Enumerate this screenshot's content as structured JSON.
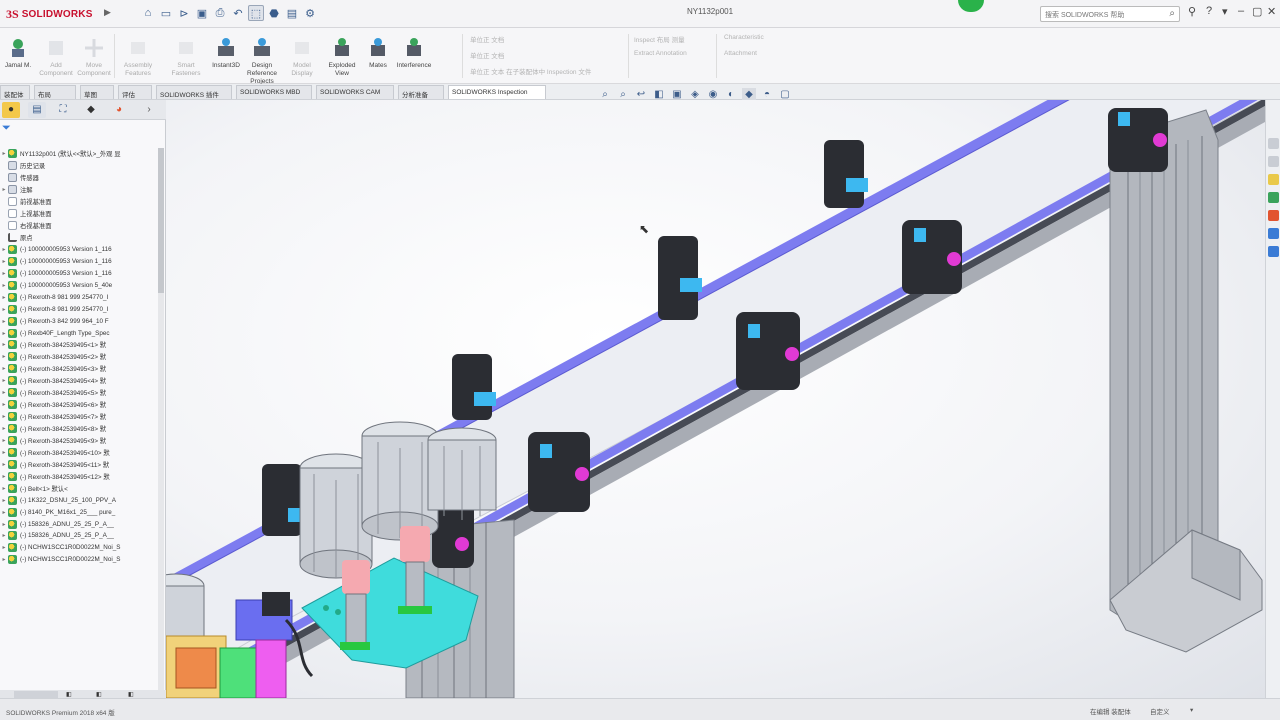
{
  "app": {
    "brand_mark": "3S",
    "brand_name": "SOLIDWORKS",
    "document_title": "NY1132p001"
  },
  "search": {
    "placeholder": "搜索 SOLIDWORKS 帮助"
  },
  "command_manager": {
    "buttons": [
      {
        "label": "Jamal M.",
        "enabled": true
      },
      {
        "label": "Add Component",
        "enabled": false
      },
      {
        "label": "Move Component",
        "enabled": false
      },
      {
        "label": "Assembly Features",
        "enabled": false
      },
      {
        "label": "Smart Fasteners",
        "enabled": true
      },
      {
        "label": "Instant3D",
        "enabled": true
      },
      {
        "label": "Design Reference Projects",
        "enabled": false
      },
      {
        "label": "Model Display",
        "enabled": true
      },
      {
        "label": "Exploded View",
        "enabled": true
      },
      {
        "label": "Mates",
        "enabled": true
      },
      {
        "label": "Interference",
        "enabled": true
      }
    ],
    "small_items": [
      "单位正 文档",
      "单位正 文档",
      "单位正 文本 在子装配体中 Inspection 文件",
      "Inspect 布局 测量",
      "Extract Annotation",
      "Characteristic",
      "Attachment"
    ]
  },
  "tabs": [
    {
      "label": "装配体",
      "active": false
    },
    {
      "label": "布局",
      "active": false
    },
    {
      "label": "草图",
      "active": false
    },
    {
      "label": "评估",
      "active": false
    },
    {
      "label": "SOLIDWORKS 插件",
      "active": false
    },
    {
      "label": "SOLIDWORKS MBD",
      "active": false
    },
    {
      "label": "SOLIDWORKS CAM",
      "active": false
    },
    {
      "label": "分析准备",
      "active": false
    },
    {
      "label": "SOLIDWORKS Inspection",
      "active": true
    }
  ],
  "feature_tree": {
    "rows": [
      {
        "label": "NY1132p001 (默认<<默认>_外观 显",
        "icon": "asm",
        "exp": "▸"
      },
      {
        "label": "历史记录",
        "icon": "folder",
        "exp": ""
      },
      {
        "label": "传感器",
        "icon": "folder",
        "exp": ""
      },
      {
        "label": "注解",
        "icon": "folder",
        "exp": "▸"
      },
      {
        "label": "前视基准面",
        "icon": "plane",
        "exp": ""
      },
      {
        "label": "上视基准面",
        "icon": "plane",
        "exp": ""
      },
      {
        "label": "右视基准面",
        "icon": "plane",
        "exp": ""
      },
      {
        "label": "原点",
        "icon": "origin",
        "exp": ""
      },
      {
        "label": "(-) 100000005953 Version 1_116",
        "icon": "asm",
        "exp": "▸"
      },
      {
        "label": "(-) 100000005953 Version 1_116",
        "icon": "asm",
        "exp": "▸"
      },
      {
        "label": "(-) 100000005953 Version 1_116",
        "icon": "asm",
        "exp": "▸"
      },
      {
        "label": "(-) 100000005953 Version 5_40e",
        "icon": "asm",
        "exp": "▸"
      },
      {
        "label": "(-) Rexroth-8 981 999 254770_I",
        "icon": "asm",
        "exp": "▸"
      },
      {
        "label": "(-) Rexroth-8 981 999 254770_I",
        "icon": "asm",
        "exp": "▸"
      },
      {
        "label": "(-) Rexroth-3 842 999 964_10 F",
        "icon": "asm",
        "exp": "▸"
      },
      {
        "label": "(-) Rexb40F_Length Type_Spec",
        "icon": "asm",
        "exp": "▸"
      },
      {
        "label": "(-) Rexroth-3842539495<1> 默",
        "icon": "asm",
        "exp": "▸"
      },
      {
        "label": "(-) Rexroth-3842539495<2> 默",
        "icon": "asm",
        "exp": "▸"
      },
      {
        "label": "(-) Rexroth-3842539495<3> 默",
        "icon": "asm",
        "exp": "▸"
      },
      {
        "label": "(-) Rexroth-3842539495<4> 默",
        "icon": "asm",
        "exp": "▸"
      },
      {
        "label": "(-) Rexroth-3842539495<5> 默",
        "icon": "asm",
        "exp": "▸"
      },
      {
        "label": "(-) Rexroth-3842539495<6> 默",
        "icon": "asm",
        "exp": "▸"
      },
      {
        "label": "(-) Rexroth-3842539495<7> 默",
        "icon": "asm",
        "exp": "▸"
      },
      {
        "label": "(-) Rexroth-3842539495<8> 默",
        "icon": "asm",
        "exp": "▸"
      },
      {
        "label": "(-) Rexroth-3842539495<9> 默",
        "icon": "asm",
        "exp": "▸"
      },
      {
        "label": "(-) Rexroth-3842539495<10> 默",
        "icon": "asm",
        "exp": "▸"
      },
      {
        "label": "(-) Rexroth-3842539495<11> 默",
        "icon": "asm",
        "exp": "▸"
      },
      {
        "label": "(-) Rexroth-3842539495<12> 默",
        "icon": "asm",
        "exp": "▸"
      },
      {
        "label": "(-) Belt<1> 默认<",
        "icon": "asm",
        "exp": "▸"
      },
      {
        "label": "(-) 1K322_DSNU_25_100_PPV_A",
        "icon": "asm",
        "exp": "▸"
      },
      {
        "label": "(-) 8140_PK_M16x1_25___ pure_",
        "icon": "asm",
        "exp": "▸"
      },
      {
        "label": "(-) 158326_ADNU_25_25_P_A__",
        "icon": "asm",
        "exp": "▸"
      },
      {
        "label": "(-) 158326_ADNU_25_25_P_A__",
        "icon": "asm",
        "exp": "▸"
      },
      {
        "label": "(-) NCHW1SCC1R0D0022M_Noi_S",
        "icon": "asm",
        "exp": "▸"
      },
      {
        "label": "(-) NCHW1SCC1R0D0022M_Noi_S",
        "icon": "asm",
        "exp": "▸"
      }
    ]
  },
  "status": {
    "left": "SOLIDWORKS Premium 2018 x64 版",
    "right": [
      "在编辑 装配体",
      "自定义"
    ]
  },
  "colors": {
    "rail_blue": "#7d7cf0",
    "bracket_dark": "#2b2d33",
    "pin_magenta": "#e13ad4",
    "clip_cyan": "#3db8f0",
    "frame_gray": "#9ea3ab",
    "plate_cyan": "#3fdcdc",
    "pink_block": "#f5a9b0",
    "green_dot": "#2ab24a"
  }
}
